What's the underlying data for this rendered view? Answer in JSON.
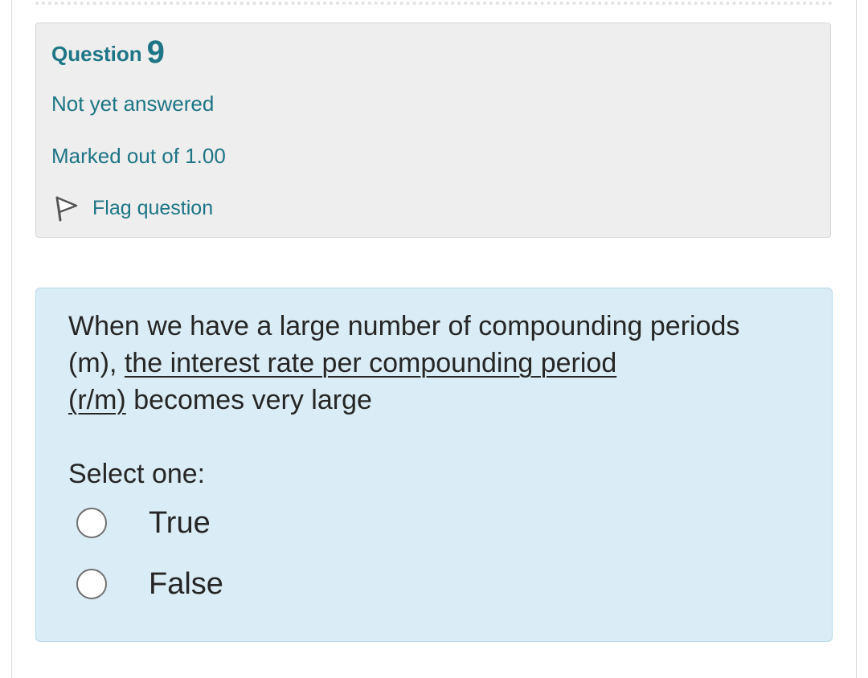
{
  "question": {
    "label": "Question",
    "number": "9",
    "state": "Not yet answered",
    "grade": "Marked out of 1.00",
    "flag_label": "Flag question",
    "flag_icon": "flag-outline-icon"
  },
  "content": {
    "text_start": "When we have a large number of compounding periods (m), ",
    "text_underlined_1": "the interest rate per compounding period",
    "text_underlined_2": "(r/m)",
    "text_end": " becomes very large",
    "prompt": "Select one:",
    "options": [
      {
        "label": "True",
        "selected": false
      },
      {
        "label": "False",
        "selected": false
      }
    ]
  },
  "colors": {
    "link_teal": "#1d7585",
    "info_bg": "#eeeeee",
    "content_bg": "#daecf5",
    "text": "#262626"
  }
}
